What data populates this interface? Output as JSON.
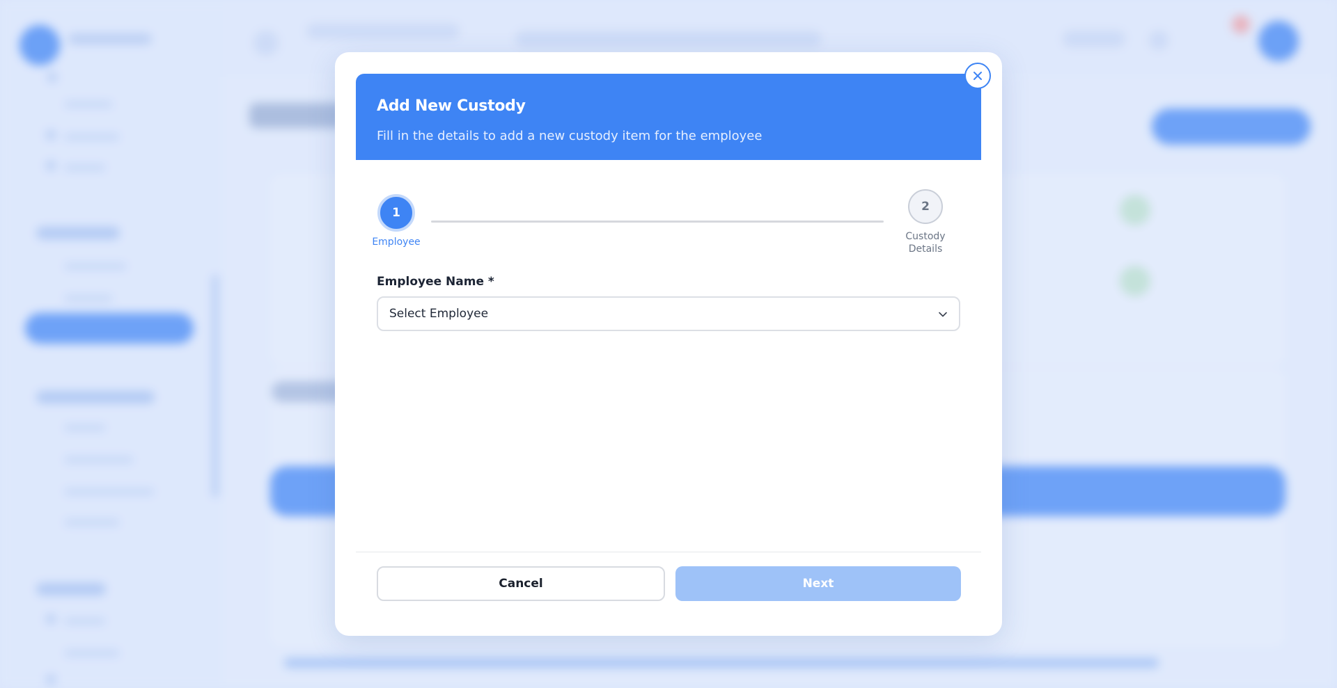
{
  "modal": {
    "title": "Add New Custody",
    "subtitle": "Fill in the details to add a new custody item for the employee",
    "close_icon": "close-icon"
  },
  "stepper": {
    "steps": [
      {
        "number": "1",
        "label": "Employee",
        "state": "active"
      },
      {
        "number": "2",
        "label": "Custody Details",
        "state": "inactive"
      }
    ]
  },
  "form": {
    "employee_name_label": "Employee Name *",
    "employee_select_value": "Select Employee",
    "chevron_icon": "chevron-down-icon"
  },
  "footer": {
    "cancel_label": "Cancel",
    "next_label": "Next"
  },
  "colors": {
    "primary": "#3e84f4",
    "disabled_primary": "#9ec2f8",
    "backdrop": "#dde8fb"
  }
}
